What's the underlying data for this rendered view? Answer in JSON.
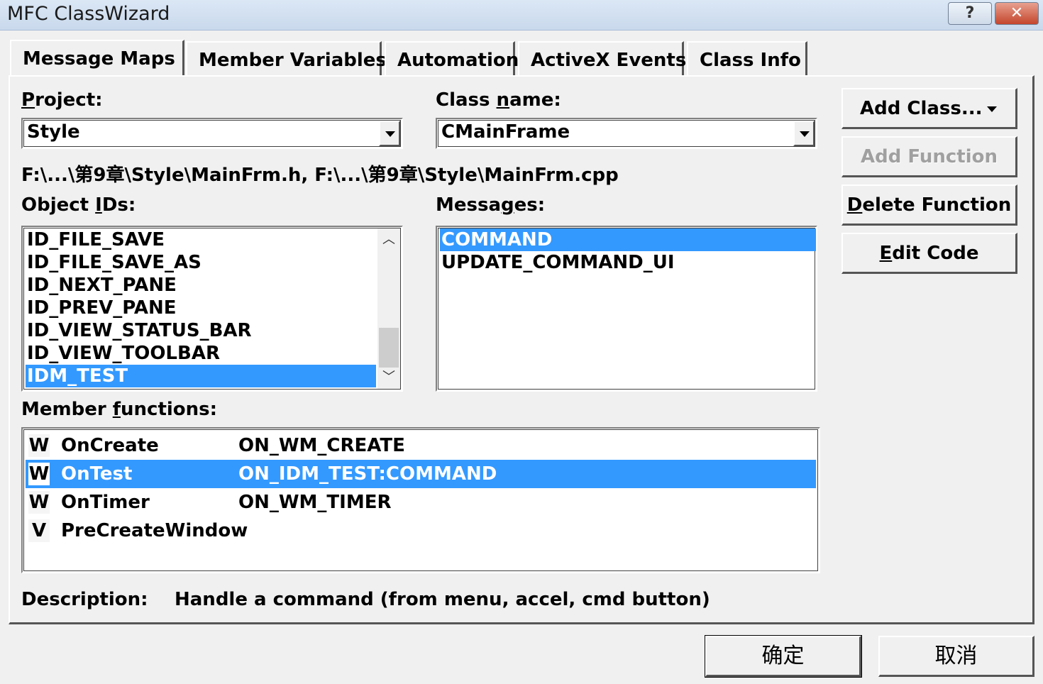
{
  "window": {
    "title": "MFC ClassWizard",
    "help_glyph": "?",
    "close_glyph": "✕"
  },
  "tabs": [
    "Message Maps",
    "Member Variables",
    "Automation",
    "ActiveX Events",
    "Class Info"
  ],
  "project": {
    "label_pre": "",
    "label_u": "P",
    "label_post": "roject:",
    "value": "Style"
  },
  "class_name": {
    "label_pre": "Class ",
    "label_u": "n",
    "label_post": "ame:",
    "value": "CMainFrame"
  },
  "file_path": "F:\\...\\第9章\\Style\\MainFrm.h, F:\\...\\第9章\\Style\\MainFrm.cpp",
  "object_ids": {
    "label_pre": "Object ",
    "label_u": "I",
    "label_post": "Ds:",
    "items": [
      "ID_FILE_SAVE",
      "ID_FILE_SAVE_AS",
      "ID_NEXT_PANE",
      "ID_PREV_PANE",
      "ID_VIEW_STATUS_BAR",
      "ID_VIEW_TOOLBAR",
      "IDM_TEST"
    ],
    "selected": "IDM_TEST"
  },
  "messages": {
    "label_pre": "Messa",
    "label_u": "g",
    "label_post": "es:",
    "items": [
      "COMMAND",
      "UPDATE_COMMAND_UI"
    ],
    "selected": "COMMAND"
  },
  "member_functions": {
    "label_pre": "Member ",
    "label_u": "f",
    "label_post": "unctions:",
    "rows": [
      {
        "icon": "W",
        "name": "OnCreate",
        "map": "ON_WM_CREATE"
      },
      {
        "icon": "W",
        "name": "OnTest",
        "map": "ON_IDM_TEST:COMMAND"
      },
      {
        "icon": "W",
        "name": "OnTimer",
        "map": "ON_WM_TIMER"
      },
      {
        "icon": "V",
        "name": "PreCreateWindow",
        "map": ""
      }
    ],
    "selected": "OnTest"
  },
  "description": {
    "label": "Description:",
    "text": "Handle a command (from menu, accel, cmd button)"
  },
  "buttons": {
    "add_class": "Add Class...",
    "add_function": "Add Function",
    "delete_function_u": "D",
    "delete_function_rest": "elete Function",
    "edit_code_u": "E",
    "edit_code_rest": "dit Code",
    "ok": "确定",
    "cancel": "取消"
  },
  "colors": {
    "selection": "#3399ff",
    "face": "#f0f0f0"
  }
}
